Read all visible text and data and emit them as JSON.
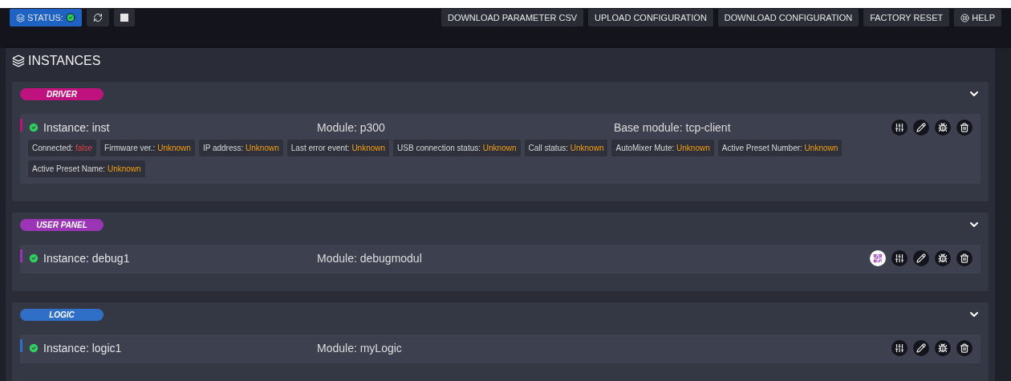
{
  "toolbar": {
    "status": {
      "label": "STATUS:",
      "ok": true
    },
    "actions": [
      "DOWNLOAD PARAMETER CSV",
      "UPLOAD CONFIGURATION",
      "DOWNLOAD CONFIGURATION",
      "FACTORY RESET"
    ],
    "help": "HELP"
  },
  "title": "INSTANCES",
  "groups": [
    {
      "name": "DRIVER",
      "color": "#c0127f",
      "expanded": true,
      "instances": [
        {
          "instance": "Instance: inst",
          "ok": true,
          "module": "Module: p300",
          "base_module": "Base module: tcp-client",
          "actions": [
            {
              "kind": "settings"
            },
            {
              "kind": "edit"
            },
            {
              "kind": "debug"
            },
            {
              "kind": "delete"
            }
          ],
          "properties": [
            {
              "label": "Connected:",
              "value": "false",
              "kind": "error"
            },
            {
              "label": "Firmware ver.:",
              "value": "Unknown",
              "kind": "unknown"
            },
            {
              "label": "IP address:",
              "value": "Unknown",
              "kind": "unknown"
            },
            {
              "label": "Last error event:",
              "value": "Unknown",
              "kind": "unknown"
            },
            {
              "label": "USB connection status:",
              "value": "Unknown",
              "kind": "unknown"
            },
            {
              "label": "Call status:",
              "value": "Unknown",
              "kind": "unknown"
            },
            {
              "label": "AutoMixer Mute:",
              "value": "Unknown",
              "kind": "unknown"
            },
            {
              "label": "Active Preset Number:",
              "value": "Unknown",
              "kind": "unknown"
            },
            {
              "label": "Active Preset Name:",
              "value": "Unknown",
              "kind": "unknown"
            }
          ]
        }
      ]
    },
    {
      "name": "USER PANEL",
      "color": "#9b34b5",
      "expanded": true,
      "instances": [
        {
          "instance": "Instance: debug1",
          "ok": true,
          "module": "Module: debugmodul",
          "actions": [
            {
              "kind": "qr"
            },
            {
              "kind": "settings"
            },
            {
              "kind": "edit"
            },
            {
              "kind": "debug"
            },
            {
              "kind": "delete"
            }
          ]
        }
      ]
    },
    {
      "name": "LOGIC",
      "color": "#2f6fc8",
      "expanded": true,
      "instances": [
        {
          "instance": "Instance: logic1",
          "ok": true,
          "module": "Module: myLogic",
          "actions": [
            {
              "kind": "settings"
            },
            {
              "kind": "edit"
            },
            {
              "kind": "debug"
            },
            {
              "kind": "delete"
            }
          ]
        }
      ]
    }
  ]
}
